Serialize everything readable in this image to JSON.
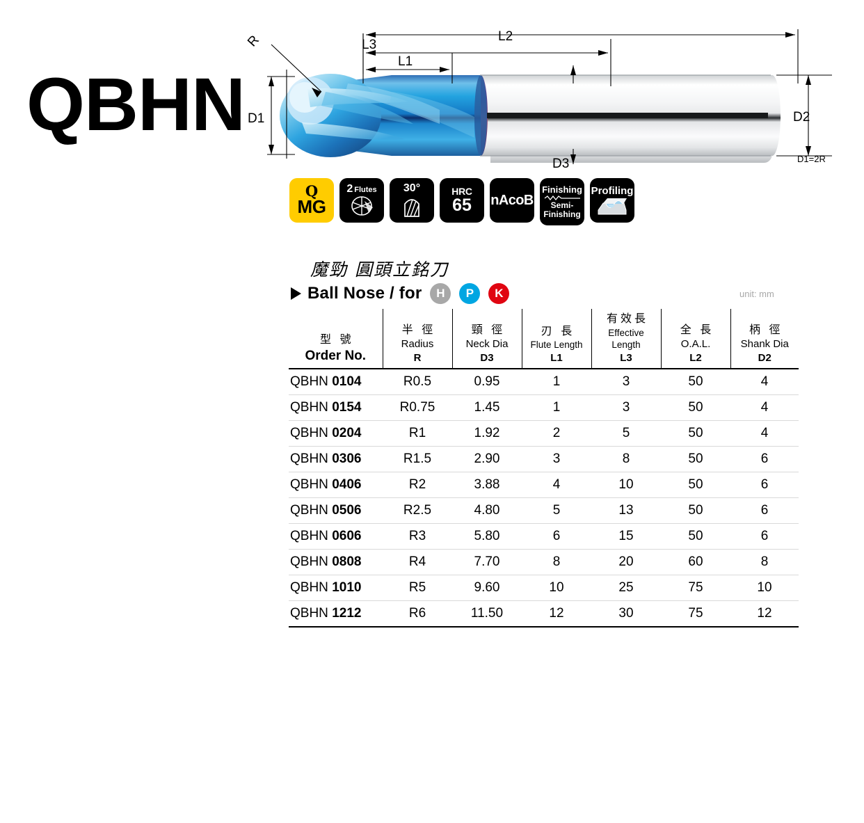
{
  "series_title": "QBHN",
  "drawing": {
    "dim_labels": {
      "r": "R",
      "l1": "L1",
      "l3": "L3",
      "l2": "L2",
      "d1": "D1",
      "d2": "D2",
      "d3": "D3",
      "note": "D1=2R"
    }
  },
  "badges": [
    {
      "name": "mg-badge",
      "style": "yellow",
      "line1": "Q",
      "line2": "MG"
    },
    {
      "name": "flutes-badge",
      "style": "black",
      "count": "2",
      "line1": "Flutes"
    },
    {
      "name": "helix-angle-badge",
      "style": "black",
      "line1": "30°"
    },
    {
      "name": "hardness-badge",
      "style": "black",
      "line1": "HRC",
      "line2": "65"
    },
    {
      "name": "coating-badge",
      "style": "black",
      "line1": "nAcoB"
    },
    {
      "name": "finishing-badge",
      "style": "black",
      "line1": "Finishing",
      "line2": "Semi-",
      "line3": "Finishing"
    },
    {
      "name": "profiling-badge",
      "style": "black",
      "line1": "Profiling"
    }
  ],
  "heading": {
    "cn": "魔勁  圓頭立銘刀",
    "en": "Ball Nose / for",
    "materials": [
      {
        "letter": "H",
        "color": "#a8a8a8"
      },
      {
        "letter": "P",
        "color": "#00a6e2"
      },
      {
        "letter": "K",
        "color": "#e00511"
      }
    ],
    "unit": "unit: mm"
  },
  "table": {
    "columns": [
      {
        "cn": "型 號",
        "en": "Order No.",
        "code": "",
        "en_class": "th-order"
      },
      {
        "cn": "半 徑",
        "en": "Radius",
        "code": "R"
      },
      {
        "cn": "頸 徑",
        "en": "Neck Dia",
        "code": "D3"
      },
      {
        "cn": "刃 長",
        "en": "Flute Length",
        "code": "L1",
        "en_class": "small"
      },
      {
        "cn": "有效長",
        "en": "Effective Length",
        "code": "L3",
        "en_class": "small"
      },
      {
        "cn": "全 長",
        "en": "O.A.L.",
        "code": "L2"
      },
      {
        "cn": "柄 徑",
        "en": "Shank Dia",
        "code": "D2"
      }
    ],
    "rows": [
      {
        "prefix": "QBHN",
        "code": "0104",
        "radius": "R0.5",
        "neck_dia": "0.95",
        "flute_length": "1",
        "effective_length": "3",
        "oal": "50",
        "shank_dia": "4"
      },
      {
        "prefix": "QBHN",
        "code": "0154",
        "radius": "R0.75",
        "neck_dia": "1.45",
        "flute_length": "1",
        "effective_length": "3",
        "oal": "50",
        "shank_dia": "4"
      },
      {
        "prefix": "QBHN",
        "code": "0204",
        "radius": "R1",
        "neck_dia": "1.92",
        "flute_length": "2",
        "effective_length": "5",
        "oal": "50",
        "shank_dia": "4"
      },
      {
        "prefix": "QBHN",
        "code": "0306",
        "radius": "R1.5",
        "neck_dia": "2.90",
        "flute_length": "3",
        "effective_length": "8",
        "oal": "50",
        "shank_dia": "6"
      },
      {
        "prefix": "QBHN",
        "code": "0406",
        "radius": "R2",
        "neck_dia": "3.88",
        "flute_length": "4",
        "effective_length": "10",
        "oal": "50",
        "shank_dia": "6"
      },
      {
        "prefix": "QBHN",
        "code": "0506",
        "radius": "R2.5",
        "neck_dia": "4.80",
        "flute_length": "5",
        "effective_length": "13",
        "oal": "50",
        "shank_dia": "6"
      },
      {
        "prefix": "QBHN",
        "code": "0606",
        "radius": "R3",
        "neck_dia": "5.80",
        "flute_length": "6",
        "effective_length": "15",
        "oal": "50",
        "shank_dia": "6"
      },
      {
        "prefix": "QBHN",
        "code": "0808",
        "radius": "R4",
        "neck_dia": "7.70",
        "flute_length": "8",
        "effective_length": "20",
        "oal": "60",
        "shank_dia": "8"
      },
      {
        "prefix": "QBHN",
        "code": "1010",
        "radius": "R5",
        "neck_dia": "9.60",
        "flute_length": "10",
        "effective_length": "25",
        "oal": "75",
        "shank_dia": "10"
      },
      {
        "prefix": "QBHN",
        "code": "1212",
        "radius": "R6",
        "neck_dia": "11.50",
        "flute_length": "12",
        "effective_length": "30",
        "oal": "75",
        "shank_dia": "12"
      }
    ]
  }
}
